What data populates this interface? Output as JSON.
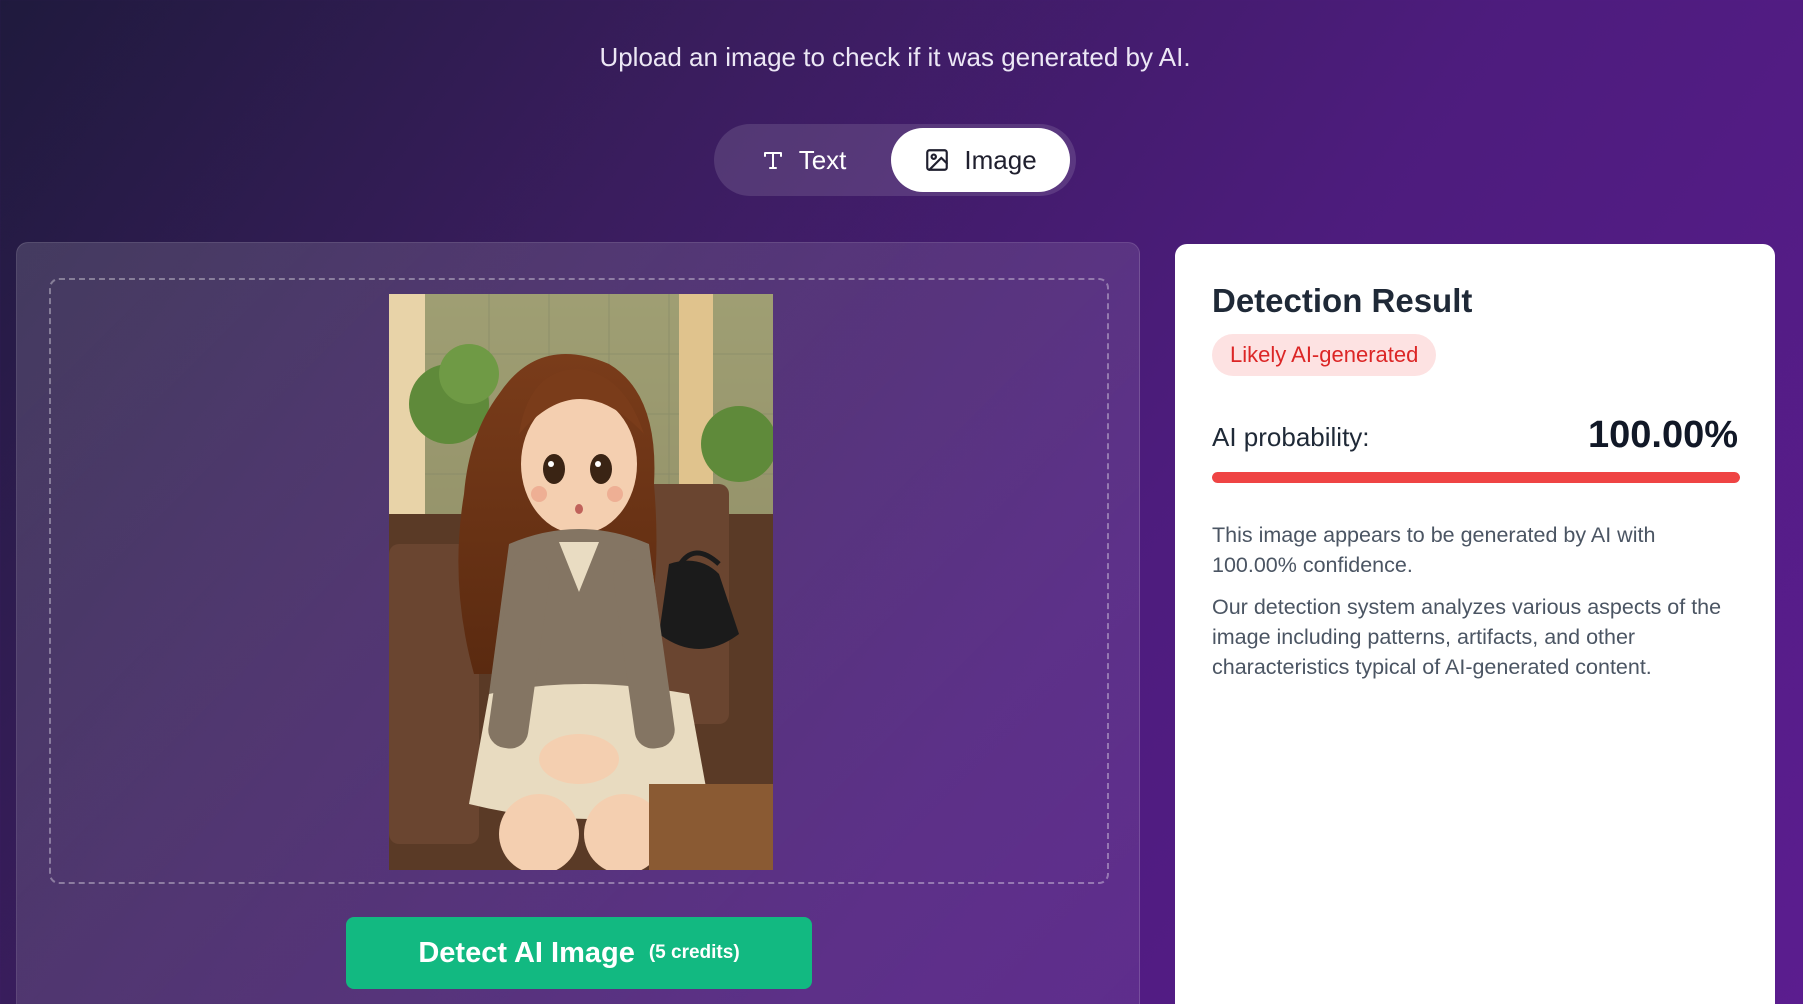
{
  "header": {
    "subtitle": "Upload an image to check if it was generated by AI."
  },
  "mode_toggle": {
    "options": [
      {
        "label": "Text",
        "icon": "text-type-icon",
        "selected": false
      },
      {
        "label": "Image",
        "icon": "image-icon",
        "selected": true
      }
    ]
  },
  "upload": {
    "preview_icon": "uploaded-image-preview",
    "detect_button_label": "Detect AI Image",
    "detect_button_credits": "(5 credits)",
    "button_color": "#12b981"
  },
  "result": {
    "title": "Detection Result",
    "verdict": "Likely AI-generated",
    "probability_label": "AI probability:",
    "probability_value": "100.00%",
    "probability_fraction": 1.0,
    "bar_color": "#ef4444",
    "summary": "This image appears to be generated by AI with 100.00% confidence.",
    "explanation": "Our detection system analyzes various aspects of the image including patterns, artifacts, and other characteristics typical of AI-generated content."
  }
}
